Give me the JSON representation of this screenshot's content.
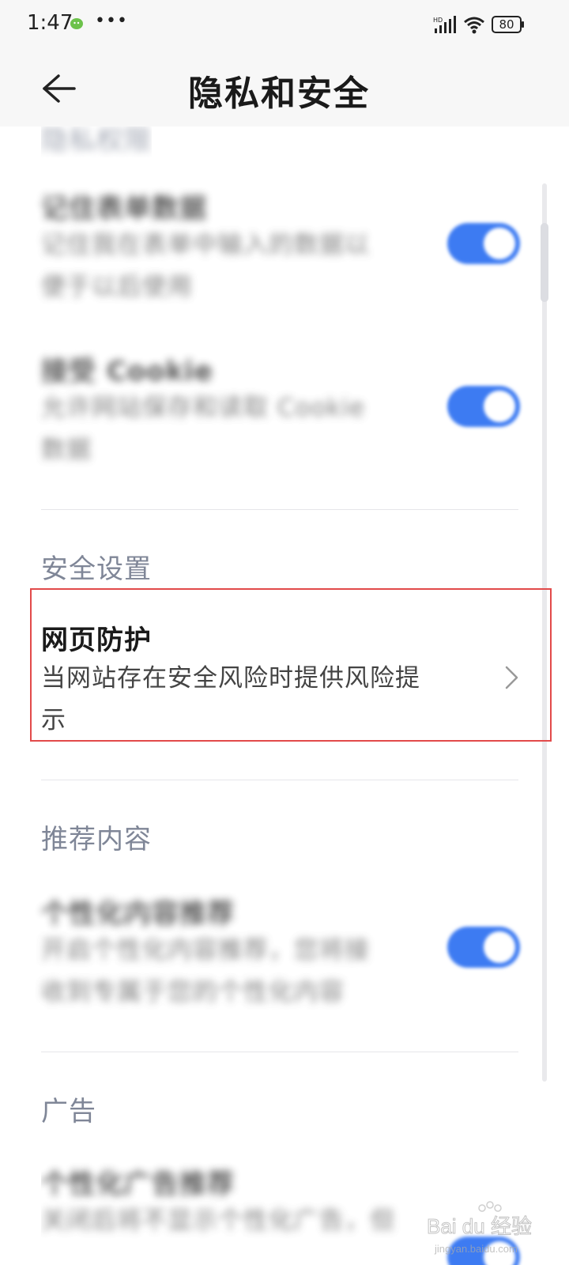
{
  "status_bar": {
    "time": "1:47",
    "more": "•••",
    "battery": "80",
    "signal_label": "HD"
  },
  "header": {
    "title": "隐私和安全"
  },
  "sections": {
    "privacy": {
      "title": "隐私权限",
      "rows": [
        {
          "title": "记住表单数据",
          "desc_line1": "记住我在表单中输入的数据以",
          "desc_line2": "便于以后使用",
          "enabled": true
        },
        {
          "title": "接受 Cookie",
          "desc_line1": "允许网站保存和读取 Cookie",
          "desc_line2": "数据",
          "enabled": true
        }
      ]
    },
    "security": {
      "title": "安全设置",
      "rows": [
        {
          "title": "网页防护",
          "desc_line1": "当网站存在安全风险时提供风险提",
          "desc_line2": "示"
        }
      ]
    },
    "recommend": {
      "title": "推荐内容",
      "rows": [
        {
          "title": "个性化内容推荐",
          "desc_line1": "开启个性化内容推荐，您将接",
          "desc_line2": "收到专属于您的个性化内容",
          "enabled": true
        }
      ]
    },
    "ads": {
      "title": "广告",
      "rows": [
        {
          "title": "个性化广告推荐",
          "desc_line1": "关闭后将不显示个性化广告，但"
        }
      ]
    }
  },
  "watermark": {
    "brand": "Bai du 经验",
    "url": "jingyan.baidu.com"
  },
  "colors": {
    "accent": "#3d7bf2",
    "highlight": "#e24a4a",
    "section_title": "#7f8697"
  }
}
